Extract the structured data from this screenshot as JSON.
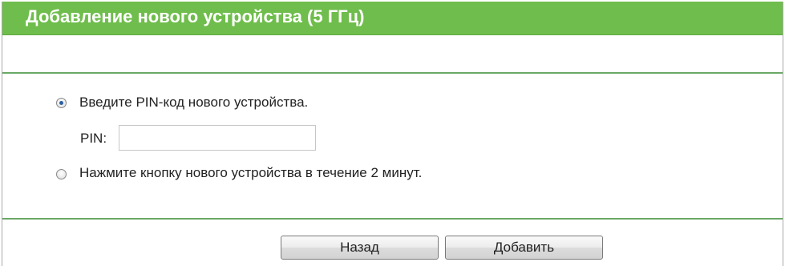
{
  "header": {
    "title": "Добавление нового устройства (5 ГГц)"
  },
  "form": {
    "option_pin": {
      "label": "Введите PIN-код нового устройства.",
      "selected": true
    },
    "pin": {
      "label": "PIN:",
      "value": ""
    },
    "option_button": {
      "label": "Нажмите кнопку нового устройства в течение 2 минут.",
      "selected": false
    }
  },
  "buttons": {
    "back_label": "Назад",
    "add_label": "Добавить"
  },
  "colors": {
    "header_bg": "#6fbd4c",
    "divider": "#6aa866",
    "radio_dot": "#2a5fa0"
  }
}
